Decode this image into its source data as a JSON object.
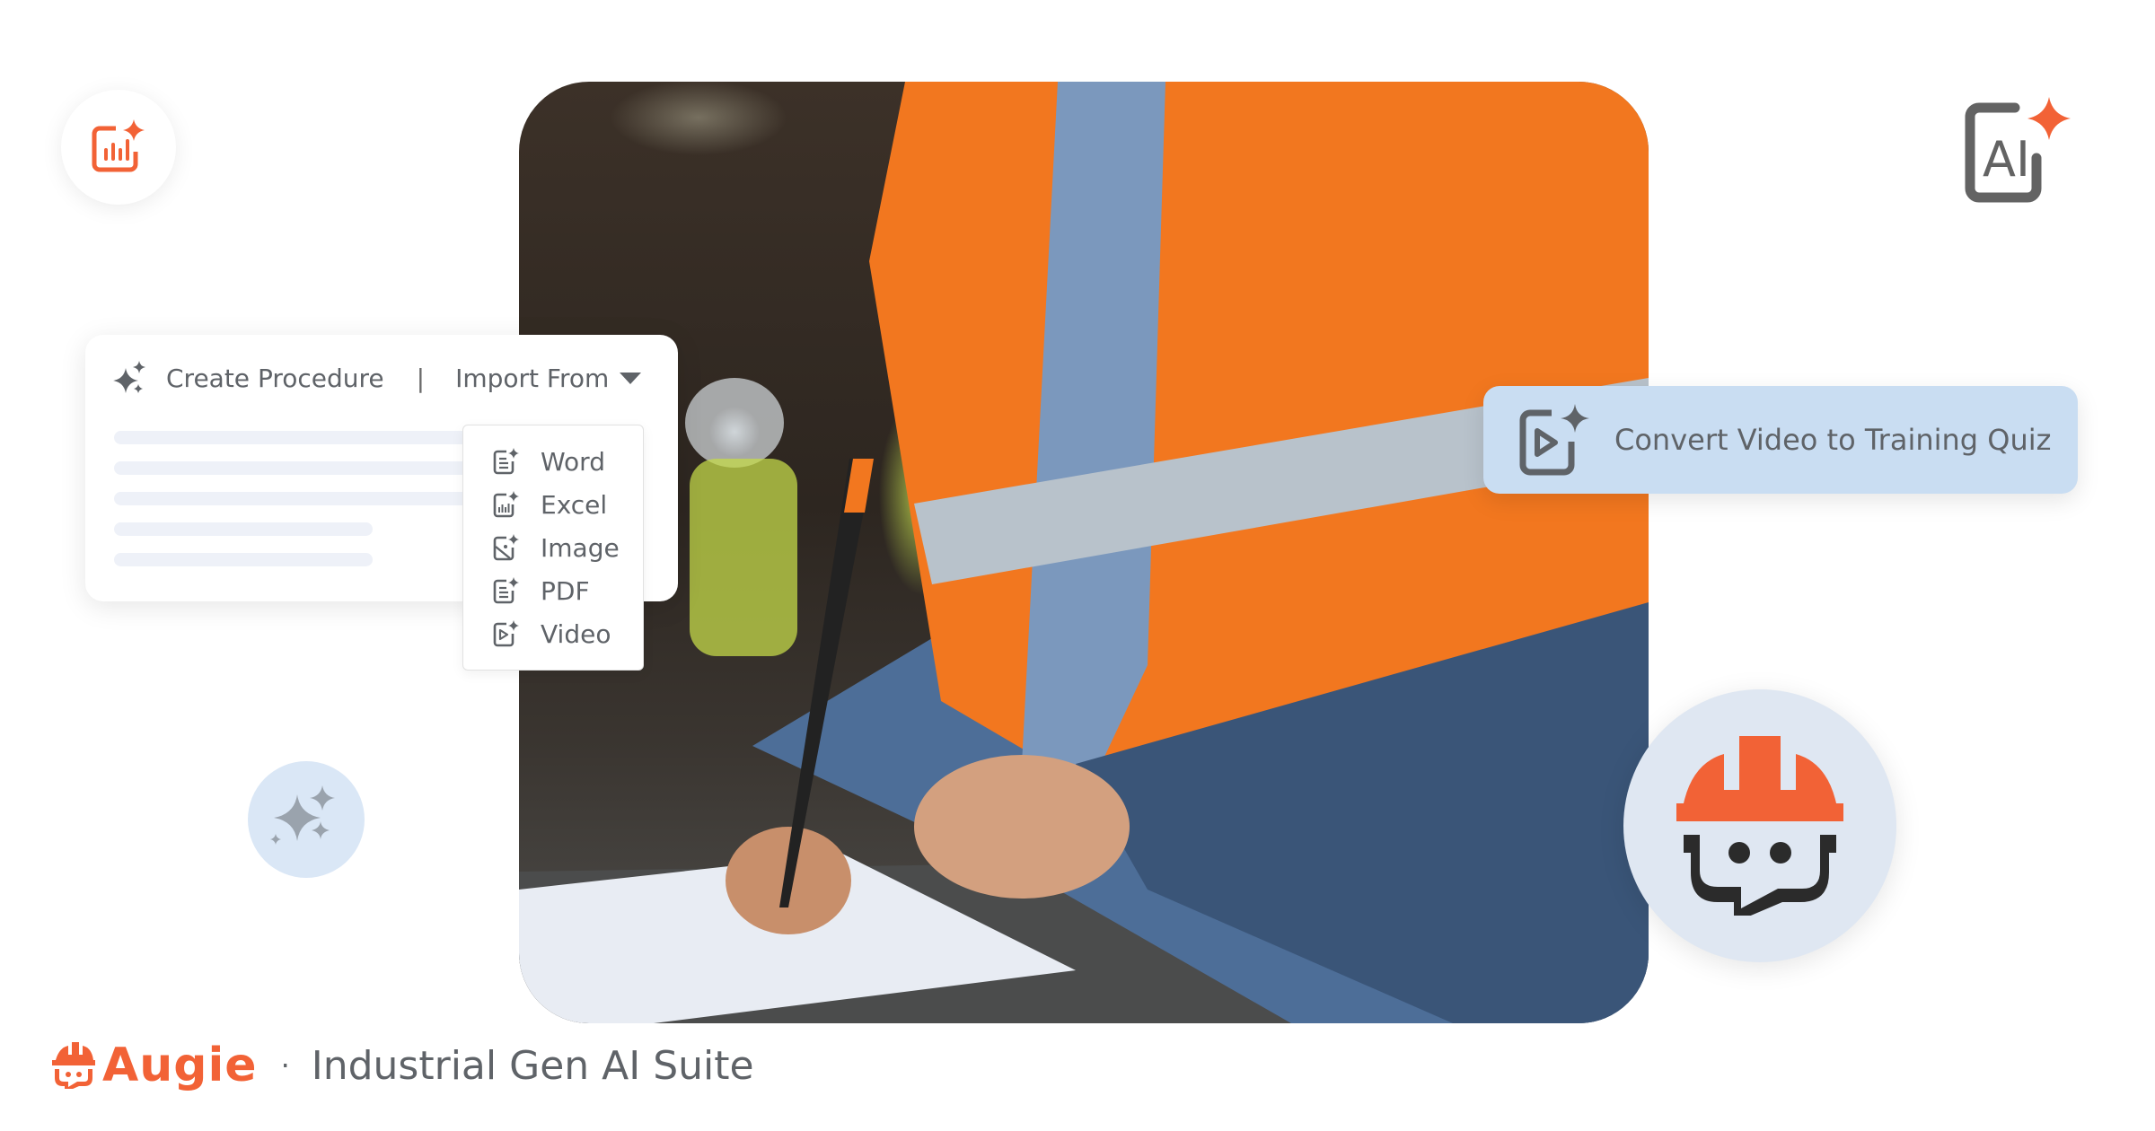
{
  "colors": {
    "brand_orange": "#f26236",
    "icon_gray": "#5f6368",
    "pill_bg": "#c9ddf2",
    "soft_blue": "#dae7f6"
  },
  "icons": {
    "top_left": "chart-sparkle-icon",
    "top_right": "ai-sparkle-icon",
    "sparkles": "sparkles-icon",
    "mascot": "hardhat-bot-chat-icon"
  },
  "procedure_card": {
    "create_label": "Create Procedure",
    "separator": "|",
    "import_label": "Import From"
  },
  "import_menu": {
    "items": [
      {
        "label": "Word",
        "icon": "document-sparkle-icon"
      },
      {
        "label": "Excel",
        "icon": "spreadsheet-sparkle-icon"
      },
      {
        "label": "Image",
        "icon": "image-sparkle-icon"
      },
      {
        "label": "PDF",
        "icon": "pdf-sparkle-icon"
      },
      {
        "label": "Video",
        "icon": "video-sparkle-icon"
      }
    ]
  },
  "convert_pill": {
    "label": "Convert Video to Training Quiz"
  },
  "footer": {
    "brand": "Augie",
    "separator": "·",
    "tagline": "Industrial Gen AI Suite"
  }
}
